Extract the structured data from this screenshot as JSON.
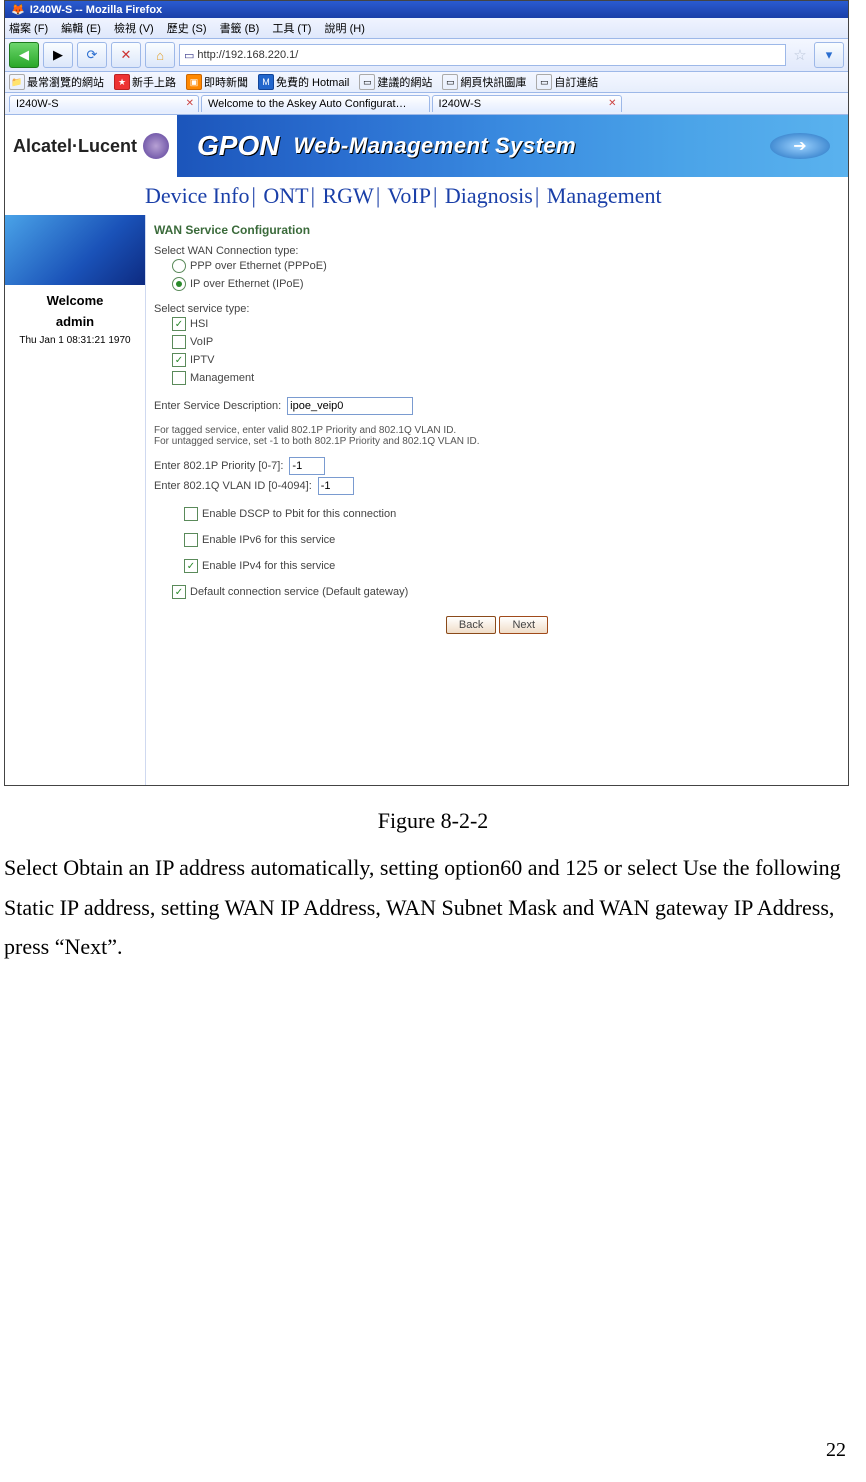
{
  "window": {
    "title": "I240W-S -- Mozilla Firefox"
  },
  "menu": {
    "m1": "檔案 (F)",
    "m2": "編輯 (E)",
    "m3": "檢視 (V)",
    "m4": "歷史 (S)",
    "m5": "書籤 (B)",
    "m6": "工具 (T)",
    "m7": "說明 (H)"
  },
  "url": "http://192.168.220.1/",
  "bookmarks": {
    "b1": "最常瀏覽的網站",
    "b2": "新手上路",
    "b3": "即時新聞",
    "b4": "免費的 Hotmail",
    "b5": "建議的網站",
    "b6": "網頁快訊圖庫",
    "b7": "自訂連結"
  },
  "tabs": {
    "t1": "I240W-S",
    "t2": "Welcome to the Askey Auto Configurat…",
    "t3": "I240W-S"
  },
  "banner": {
    "brand": "Alcatel·Lucent",
    "gpon": "GPON",
    "wms": "Web-Management System"
  },
  "nav": {
    "n1": "Device Info",
    "n2": "ONT",
    "n3": "RGW",
    "n4": "VoIP",
    "n5": "Diagnosis",
    "n6": "Management"
  },
  "left": {
    "welcome": "Welcome",
    "admin": "admin",
    "ts": "Thu Jan 1 08:31:21 1970"
  },
  "form": {
    "title": "WAN Service Configuration",
    "selConnType": "Select WAN Connection type:",
    "pppoe": "PPP over Ethernet (PPPoE)",
    "ipoe": "IP over Ethernet (IPoE)",
    "selSvcType": "Select service type:",
    "hsi": "HSI",
    "voip": "VoIP",
    "iptv": "IPTV",
    "mgmt": "Management",
    "descLabel": "Enter Service Description:",
    "descValue": "ipoe_veip0",
    "tagHelp1": "For tagged service, enter valid 802.1P Priority and 802.1Q VLAN ID.",
    "tagHelp2": "For untagged service, set -1 to both 802.1P Priority and 802.1Q VLAN ID.",
    "prioLabel": "Enter 802.1P Priority [0-7]:",
    "prioVal": "-1",
    "vlanLabel": "Enter 802.1Q VLAN ID [0-4094]:",
    "vlanVal": "-1",
    "dscp": "Enable DSCP to Pbit for this connection",
    "ipv6": "Enable IPv6 for this service",
    "ipv4": "Enable IPv4 for this service",
    "defgw": "Default connection service (Default gateway)",
    "back": "Back",
    "next": "Next"
  },
  "caption": "Figure 8-2-2",
  "paragraph": "Select Obtain an IP address automatically, setting option60 and 125 or select Use the following Static IP address, setting WAN IP Address, WAN Subnet Mask and WAN gateway IP Address, press “Next”.",
  "page_number": "22"
}
